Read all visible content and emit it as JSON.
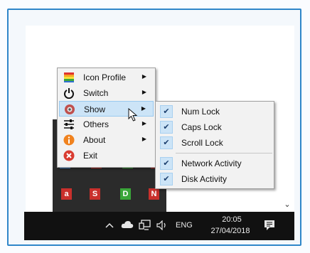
{
  "context_menu": {
    "items": [
      {
        "label": "Icon Profile",
        "icon": "rainbow-flag-icon",
        "has_submenu": true
      },
      {
        "label": "Switch",
        "icon": "power-icon",
        "has_submenu": true
      },
      {
        "label": "Show",
        "icon": "eye-icon",
        "has_submenu": true,
        "highlighted": true
      },
      {
        "label": "Others",
        "icon": "sliders-icon",
        "has_submenu": true
      },
      {
        "label": "About",
        "icon": "info-icon",
        "has_submenu": true
      },
      {
        "label": "Exit",
        "icon": "exit-icon",
        "has_submenu": false
      }
    ]
  },
  "show_submenu": {
    "items": [
      {
        "label": "Num Lock",
        "checked": true
      },
      {
        "label": "Caps Lock",
        "checked": true
      },
      {
        "label": "Scroll Lock",
        "checked": true
      },
      {
        "label": "Network Activity",
        "checked": true
      },
      {
        "label": "Disk Activity",
        "checked": true
      }
    ]
  },
  "tray_flyout": {
    "icons": [
      {
        "letter": "a",
        "color": "#c9302c"
      },
      {
        "letter": "S",
        "color": "#c9302c"
      },
      {
        "letter": "D",
        "color": "#3aa639"
      },
      {
        "letter": "N",
        "color": "#c9302c"
      }
    ]
  },
  "taskbar": {
    "language": "ENG",
    "time": "20:05",
    "date": "27/04/2018"
  },
  "colors": {
    "accent_border": "#2f86c9",
    "highlight": "#cce4f7",
    "taskbar": "#111111"
  }
}
